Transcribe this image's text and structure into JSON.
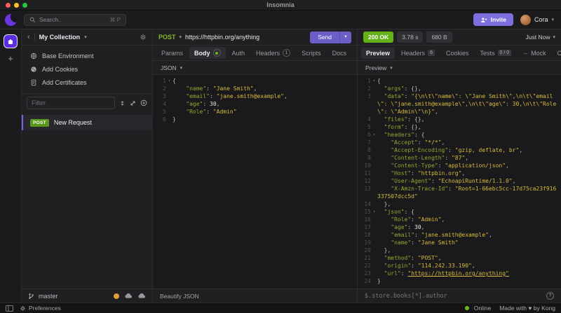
{
  "titlebar": {
    "title": "Insomnia"
  },
  "header": {
    "search_placeholder": "Search..",
    "search_shortcut": "⌘ P",
    "invite_label": "Invite",
    "user_name": "Cora"
  },
  "sidebar": {
    "collection_name": "My Collection",
    "env_items": [
      {
        "icon": "globe-icon",
        "label": "Base Environment"
      },
      {
        "icon": "cookie-icon",
        "label": "Add Cookies"
      },
      {
        "icon": "certificate-icon",
        "label": "Add Certificates"
      }
    ],
    "filter_placeholder": "Filter",
    "requests": [
      {
        "method": "POST",
        "name": "New Request",
        "selected": true
      }
    ],
    "branch_name": "master"
  },
  "request": {
    "method": "POST",
    "url": "https://httpbin.org/anything",
    "send_label": "Send",
    "tabs": [
      {
        "label": "Params"
      },
      {
        "label": "Body",
        "active": true,
        "dot": true
      },
      {
        "label": "Auth"
      },
      {
        "label": "Headers",
        "badge": "1",
        "badge_style": "circle"
      },
      {
        "label": "Scripts"
      },
      {
        "label": "Docs"
      }
    ],
    "body_type": "JSON",
    "footer_label": "Beautify JSON",
    "code": [
      {
        "n": "1",
        "f": true,
        "s": [
          [
            "p",
            "{"
          ]
        ]
      },
      {
        "n": "2",
        "s": [
          [
            "p",
            "    "
          ],
          [
            "k",
            "\"name\""
          ],
          [
            "p",
            ": "
          ],
          [
            "v",
            "\"Jane Smith\""
          ],
          [
            "p",
            ","
          ]
        ]
      },
      {
        "n": "3",
        "s": [
          [
            "p",
            "    "
          ],
          [
            "k",
            "\"email\""
          ],
          [
            "p",
            ": "
          ],
          [
            "v",
            "\"jane.smith@example\""
          ],
          [
            "p",
            ","
          ]
        ]
      },
      {
        "n": "4",
        "s": [
          [
            "p",
            "    "
          ],
          [
            "k",
            "\"age\""
          ],
          [
            "p",
            ": "
          ],
          [
            "num",
            "30"
          ],
          [
            "p",
            ","
          ]
        ]
      },
      {
        "n": "5",
        "s": [
          [
            "p",
            "    "
          ],
          [
            "k",
            "\"Role\""
          ],
          [
            "p",
            ": "
          ],
          [
            "v",
            "\"Admin\""
          ]
        ]
      },
      {
        "n": "6",
        "s": [
          [
            "p",
            "}"
          ]
        ]
      }
    ]
  },
  "response": {
    "status": "200 OK",
    "time": "3.78 s",
    "size": "680 B",
    "history_label": "Just Now",
    "tabs": [
      {
        "label": "Preview",
        "active": true
      },
      {
        "label": "Headers",
        "badge": "6",
        "badge_style": "rect"
      },
      {
        "label": "Cookies"
      },
      {
        "label": "Tests",
        "badge": "0 / 0",
        "badge_style": "rect"
      },
      {
        "label": "Mock",
        "arrow": true
      },
      {
        "label": "Console"
      }
    ],
    "preview_mode": "Preview",
    "filter_placeholder": "$.store.books[*].author",
    "code": [
      {
        "n": "1",
        "f": true,
        "s": [
          [
            "p",
            "{"
          ]
        ]
      },
      {
        "n": "2",
        "s": [
          [
            "p",
            "  "
          ],
          [
            "k",
            "\"args\""
          ],
          [
            "p",
            ": {},"
          ]
        ]
      },
      {
        "n": "3",
        "s": [
          [
            "p",
            "  "
          ],
          [
            "k",
            "\"data\""
          ],
          [
            "p",
            ": "
          ],
          [
            "v",
            "\"{\\n\\t\\\"name\\\": \\\"Jane Smith\\\",\\n\\t\\\"email\\\": \\\"jane.smith@example\\\",\\n\\t\\\"age\\\": 30,\\n\\t\\\"Role\\\": \\\"Admin\\\"\\n}\""
          ],
          [
            "p",
            ","
          ]
        ]
      },
      {
        "n": "4",
        "s": [
          [
            "p",
            "  "
          ],
          [
            "k",
            "\"files\""
          ],
          [
            "p",
            ": {},"
          ]
        ]
      },
      {
        "n": "5",
        "s": [
          [
            "p",
            "  "
          ],
          [
            "k",
            "\"form\""
          ],
          [
            "p",
            ": {},"
          ]
        ]
      },
      {
        "n": "6",
        "f": true,
        "s": [
          [
            "p",
            "  "
          ],
          [
            "k",
            "\"headers\""
          ],
          [
            "p",
            ": {"
          ]
        ]
      },
      {
        "n": "7",
        "s": [
          [
            "p",
            "    "
          ],
          [
            "k",
            "\"Accept\""
          ],
          [
            "p",
            ": "
          ],
          [
            "v",
            "\"*/*\""
          ],
          [
            "p",
            ","
          ]
        ]
      },
      {
        "n": "8",
        "s": [
          [
            "p",
            "    "
          ],
          [
            "k",
            "\"Accept-Encoding\""
          ],
          [
            "p",
            ": "
          ],
          [
            "v",
            "\"gzip, deflate, br\""
          ],
          [
            "p",
            ","
          ]
        ]
      },
      {
        "n": "9",
        "s": [
          [
            "p",
            "    "
          ],
          [
            "k",
            "\"Content-Length\""
          ],
          [
            "p",
            ": "
          ],
          [
            "v",
            "\"87\""
          ],
          [
            "p",
            ","
          ]
        ]
      },
      {
        "n": "10",
        "s": [
          [
            "p",
            "    "
          ],
          [
            "k",
            "\"Content-Type\""
          ],
          [
            "p",
            ": "
          ],
          [
            "v",
            "\"application/json\""
          ],
          [
            "p",
            ","
          ]
        ]
      },
      {
        "n": "11",
        "s": [
          [
            "p",
            "    "
          ],
          [
            "k",
            "\"Host\""
          ],
          [
            "p",
            ": "
          ],
          [
            "v",
            "\"httpbin.org\""
          ],
          [
            "p",
            ","
          ]
        ]
      },
      {
        "n": "12",
        "s": [
          [
            "p",
            "    "
          ],
          [
            "k",
            "\"User-Agent\""
          ],
          [
            "p",
            ": "
          ],
          [
            "v",
            "\"EchoapiRuntime/1.1.0\""
          ],
          [
            "p",
            ","
          ]
        ]
      },
      {
        "n": "13",
        "s": [
          [
            "p",
            "    "
          ],
          [
            "k",
            "\"X-Amzn-Trace-Id\""
          ],
          [
            "p",
            ": "
          ],
          [
            "v",
            "\"Root=1-66ebc5cc-17d75ca23f916337507dcc5d\""
          ]
        ]
      },
      {
        "n": "14",
        "s": [
          [
            "p",
            "  },"
          ]
        ]
      },
      {
        "n": "15",
        "f": true,
        "s": [
          [
            "p",
            "  "
          ],
          [
            "k",
            "\"json\""
          ],
          [
            "p",
            ": {"
          ]
        ]
      },
      {
        "n": "16",
        "s": [
          [
            "p",
            "    "
          ],
          [
            "k",
            "\"Role\""
          ],
          [
            "p",
            ": "
          ],
          [
            "v",
            "\"Admin\""
          ],
          [
            "p",
            ","
          ]
        ]
      },
      {
        "n": "17",
        "s": [
          [
            "p",
            "    "
          ],
          [
            "k",
            "\"age\""
          ],
          [
            "p",
            ": "
          ],
          [
            "num",
            "30"
          ],
          [
            "p",
            ","
          ]
        ]
      },
      {
        "n": "18",
        "s": [
          [
            "p",
            "    "
          ],
          [
            "k",
            "\"email\""
          ],
          [
            "p",
            ": "
          ],
          [
            "v",
            "\"jane.smith@example\""
          ],
          [
            "p",
            ","
          ]
        ]
      },
      {
        "n": "19",
        "s": [
          [
            "p",
            "    "
          ],
          [
            "k",
            "\"name\""
          ],
          [
            "p",
            ": "
          ],
          [
            "v",
            "\"Jane Smith\""
          ]
        ]
      },
      {
        "n": "20",
        "s": [
          [
            "p",
            "  },"
          ]
        ]
      },
      {
        "n": "21",
        "s": [
          [
            "p",
            "  "
          ],
          [
            "k",
            "\"method\""
          ],
          [
            "p",
            ": "
          ],
          [
            "v",
            "\"POST\""
          ],
          [
            "p",
            ","
          ]
        ]
      },
      {
        "n": "22",
        "s": [
          [
            "p",
            "  "
          ],
          [
            "k",
            "\"origin\""
          ],
          [
            "p",
            ": "
          ],
          [
            "v",
            "\"114.242.33.190\""
          ],
          [
            "p",
            ","
          ]
        ]
      },
      {
        "n": "23",
        "s": [
          [
            "p",
            "  "
          ],
          [
            "k",
            "\"url\""
          ],
          [
            "p",
            ": "
          ],
          [
            "u",
            "\"https://httpbin.org/anything\""
          ]
        ]
      },
      {
        "n": "24",
        "s": [
          [
            "p",
            "}"
          ]
        ]
      }
    ]
  },
  "statusbar": {
    "preferences_label": "Preferences",
    "online_label": "Online",
    "credit": "Made with ♥ by Kong"
  },
  "colors": {
    "accent_purple": "#6b5ec9",
    "invite_purple": "#7e6fe0",
    "logo_purple": "#6a36df",
    "success_green": "#64b11a",
    "method_green": "#84b829",
    "post_badge_green": "#59981d",
    "code_key": "#9aa42f",
    "code_string": "#d8bb3e",
    "warning_orange": "#e09b3d"
  }
}
